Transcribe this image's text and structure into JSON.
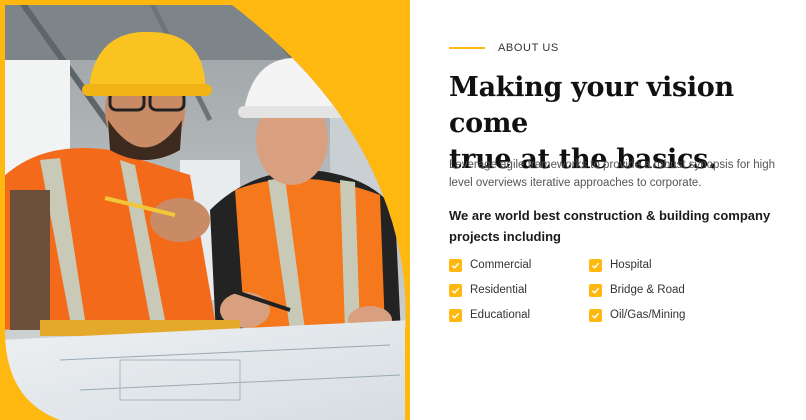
{
  "about": {
    "label": "ABOUT US"
  },
  "hero": {
    "title_line1": "Making your vision come",
    "title_line2": "true at the basics.",
    "description": "Leverage agile frameworks to provide a robust synopsis for high level overviews iterative approaches to corporate.",
    "subheading": "We are world best construction & building company projects including"
  },
  "features": [
    {
      "label": "Commercial",
      "icon": "check-icon"
    },
    {
      "label": "Hospital",
      "icon": "check-icon"
    },
    {
      "label": "Residential",
      "icon": "check-icon"
    },
    {
      "label": "Bridge & Road",
      "icon": "check-icon"
    },
    {
      "label": "Educational",
      "icon": "check-icon"
    },
    {
      "label": "Oil/Gas/Mining",
      "icon": "check-icon"
    }
  ],
  "colors": {
    "accent": "#ffb80f",
    "heading": "#111111",
    "text": "#555555"
  },
  "image": {
    "description_icon": "construction-workers-photo"
  }
}
